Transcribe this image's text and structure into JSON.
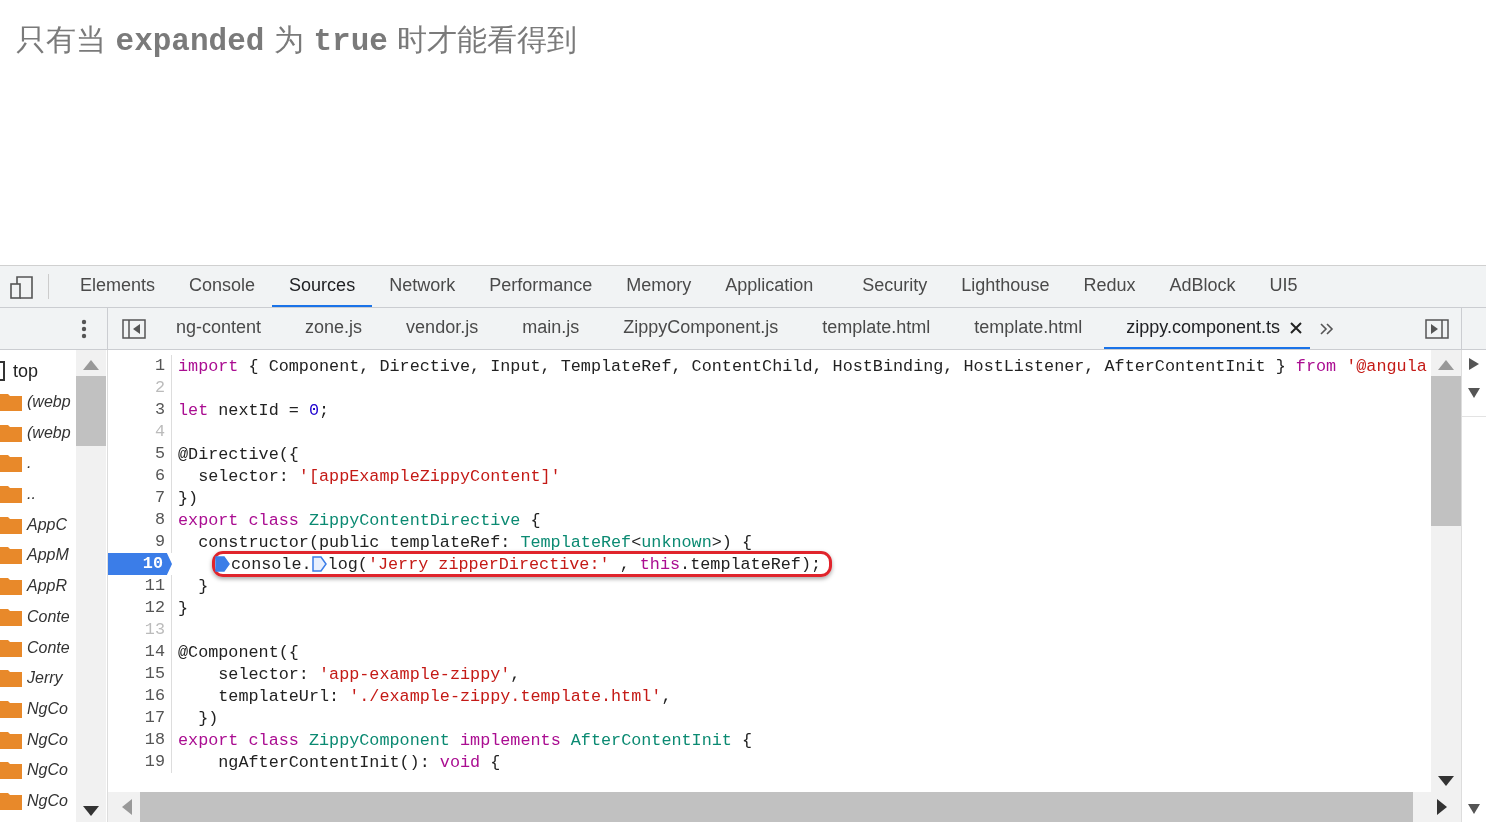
{
  "heading": [
    {
      "kind": "text",
      "text": "只有当 "
    },
    {
      "kind": "code",
      "text": "expanded"
    },
    {
      "kind": "text",
      "text": " 为 "
    },
    {
      "kind": "code",
      "text": "true"
    },
    {
      "kind": "text",
      "text": " 时才能看得到"
    }
  ],
  "panel_tabs": [
    {
      "label": "Elements",
      "selected": false
    },
    {
      "label": "Console",
      "selected": false
    },
    {
      "label": "Sources",
      "selected": true
    },
    {
      "label": "Network",
      "selected": false
    },
    {
      "label": "Performance",
      "selected": false
    },
    {
      "label": "Memory",
      "selected": false
    },
    {
      "label": "Application",
      "selected": false
    },
    {
      "label": "Security",
      "selected": false
    },
    {
      "label": "Lighthouse",
      "selected": false
    },
    {
      "label": "Redux",
      "selected": false
    },
    {
      "label": "AdBlock",
      "selected": false
    },
    {
      "label": "UI5",
      "selected": false
    }
  ],
  "file_tabs": [
    {
      "label": "ng-content",
      "selected": false
    },
    {
      "label": "zone.js",
      "selected": false
    },
    {
      "label": "vendor.js",
      "selected": false
    },
    {
      "label": "main.js",
      "selected": false
    },
    {
      "label": "ZippyComponent.js",
      "selected": false
    },
    {
      "label": "template.html",
      "selected": false
    },
    {
      "label": "template.html",
      "selected": false
    },
    {
      "label": "zippy.component.ts",
      "selected": true
    }
  ],
  "file_tree": [
    {
      "label": "top",
      "children": [
        {
          "label": "(webp"
        },
        {
          "label": "(webp"
        },
        {
          "label": "."
        },
        {
          "label": ".."
        },
        {
          "label": "AppC"
        },
        {
          "label": "AppM"
        },
        {
          "label": "AppR"
        },
        {
          "label": "Conte"
        },
        {
          "label": "Conte"
        },
        {
          "label": "Jerry"
        },
        {
          "label": "NgCo"
        },
        {
          "label": "NgCo"
        },
        {
          "label": "NgCo"
        },
        {
          "label": "NgCo"
        }
      ]
    }
  ],
  "code_lines": [
    {
      "number": "1",
      "tokens": [
        {
          "kind": "kw",
          "text": "import"
        },
        {
          "kind": "plain",
          "text": " { Component, Directive, Input, TemplateRef, ContentChild, HostBinding, HostListener, AfterContentInit } "
        },
        {
          "kind": "kw",
          "text": "from"
        },
        {
          "kind": "str",
          "text": " '@angula"
        }
      ]
    },
    {
      "number": "2"
    },
    {
      "number": "3",
      "tokens": [
        {
          "kind": "kw",
          "text": "let"
        },
        {
          "kind": "plain",
          "text": " nextId = "
        },
        {
          "kind": "num",
          "text": "0"
        },
        {
          "kind": "plain",
          "text": ";"
        }
      ]
    },
    {
      "number": "4"
    },
    {
      "number": "5",
      "tokens": [
        {
          "kind": "plain",
          "text": "@Directive({"
        }
      ]
    },
    {
      "number": "6",
      "tokens": [
        {
          "kind": "plain",
          "text": "  selector: "
        },
        {
          "kind": "str",
          "text": "'[appExampleZippyContent]'"
        }
      ]
    },
    {
      "number": "7",
      "tokens": [
        {
          "kind": "plain",
          "text": "})"
        }
      ]
    },
    {
      "number": "8",
      "tokens": [
        {
          "kind": "kw",
          "text": "export class"
        },
        {
          "kind": "type",
          "text": " ZippyContentDirective"
        },
        {
          "kind": "plain",
          "text": " {"
        }
      ]
    },
    {
      "number": "9",
      "tokens": [
        {
          "kind": "plain",
          "text": "  constructor(public templateRef: "
        },
        {
          "kind": "type",
          "text": "TemplateRef"
        },
        {
          "kind": "plain",
          "text": "<"
        },
        {
          "kind": "type",
          "text": "unknown"
        },
        {
          "kind": "plain",
          "text": ">) {"
        }
      ]
    },
    {
      "number": "10",
      "breakpoint": true,
      "circled": true,
      "tokens": [
        {
          "kind": "bp",
          "active": true
        },
        {
          "kind": "plain",
          "text": "console."
        },
        {
          "kind": "bp",
          "active": false
        },
        {
          "kind": "plain",
          "text": "log("
        },
        {
          "kind": "str",
          "text": "'Jerry zipperDirective:'"
        },
        {
          "kind": "plain",
          "text": " , "
        },
        {
          "kind": "kw",
          "text": "this"
        },
        {
          "kind": "plain",
          "text": ".templateRef);"
        }
      ]
    },
    {
      "number": "11",
      "tokens": [
        {
          "kind": "plain",
          "text": "  }"
        }
      ]
    },
    {
      "number": "12",
      "tokens": [
        {
          "kind": "plain",
          "text": "}"
        }
      ]
    },
    {
      "number": "13"
    },
    {
      "number": "14",
      "tokens": [
        {
          "kind": "plain",
          "text": "@Component({"
        }
      ]
    },
    {
      "number": "15",
      "tokens": [
        {
          "kind": "plain",
          "text": "    selector: "
        },
        {
          "kind": "str",
          "text": "'app-example-zippy'"
        },
        {
          "kind": "plain",
          "text": ","
        }
      ]
    },
    {
      "number": "16",
      "tokens": [
        {
          "kind": "plain",
          "text": "    templateUrl: "
        },
        {
          "kind": "str",
          "text": "'./example-zippy.template.html'"
        },
        {
          "kind": "plain",
          "text": ","
        }
      ]
    },
    {
      "number": "17",
      "tokens": [
        {
          "kind": "plain",
          "text": "  })"
        }
      ]
    },
    {
      "number": "18",
      "tokens": [
        {
          "kind": "kw",
          "text": "export class"
        },
        {
          "kind": "type",
          "text": " ZippyComponent"
        },
        {
          "kind": "kw",
          "text": " implements"
        },
        {
          "kind": "type",
          "text": " AfterContentInit"
        },
        {
          "kind": "plain",
          "text": " {"
        }
      ]
    },
    {
      "number": "19",
      "tokens": [
        {
          "kind": "plain",
          "text": "    ngAfterContentInit(): "
        },
        {
          "kind": "kw",
          "text": "void"
        },
        {
          "kind": "plain",
          "text": " {"
        }
      ]
    }
  ]
}
